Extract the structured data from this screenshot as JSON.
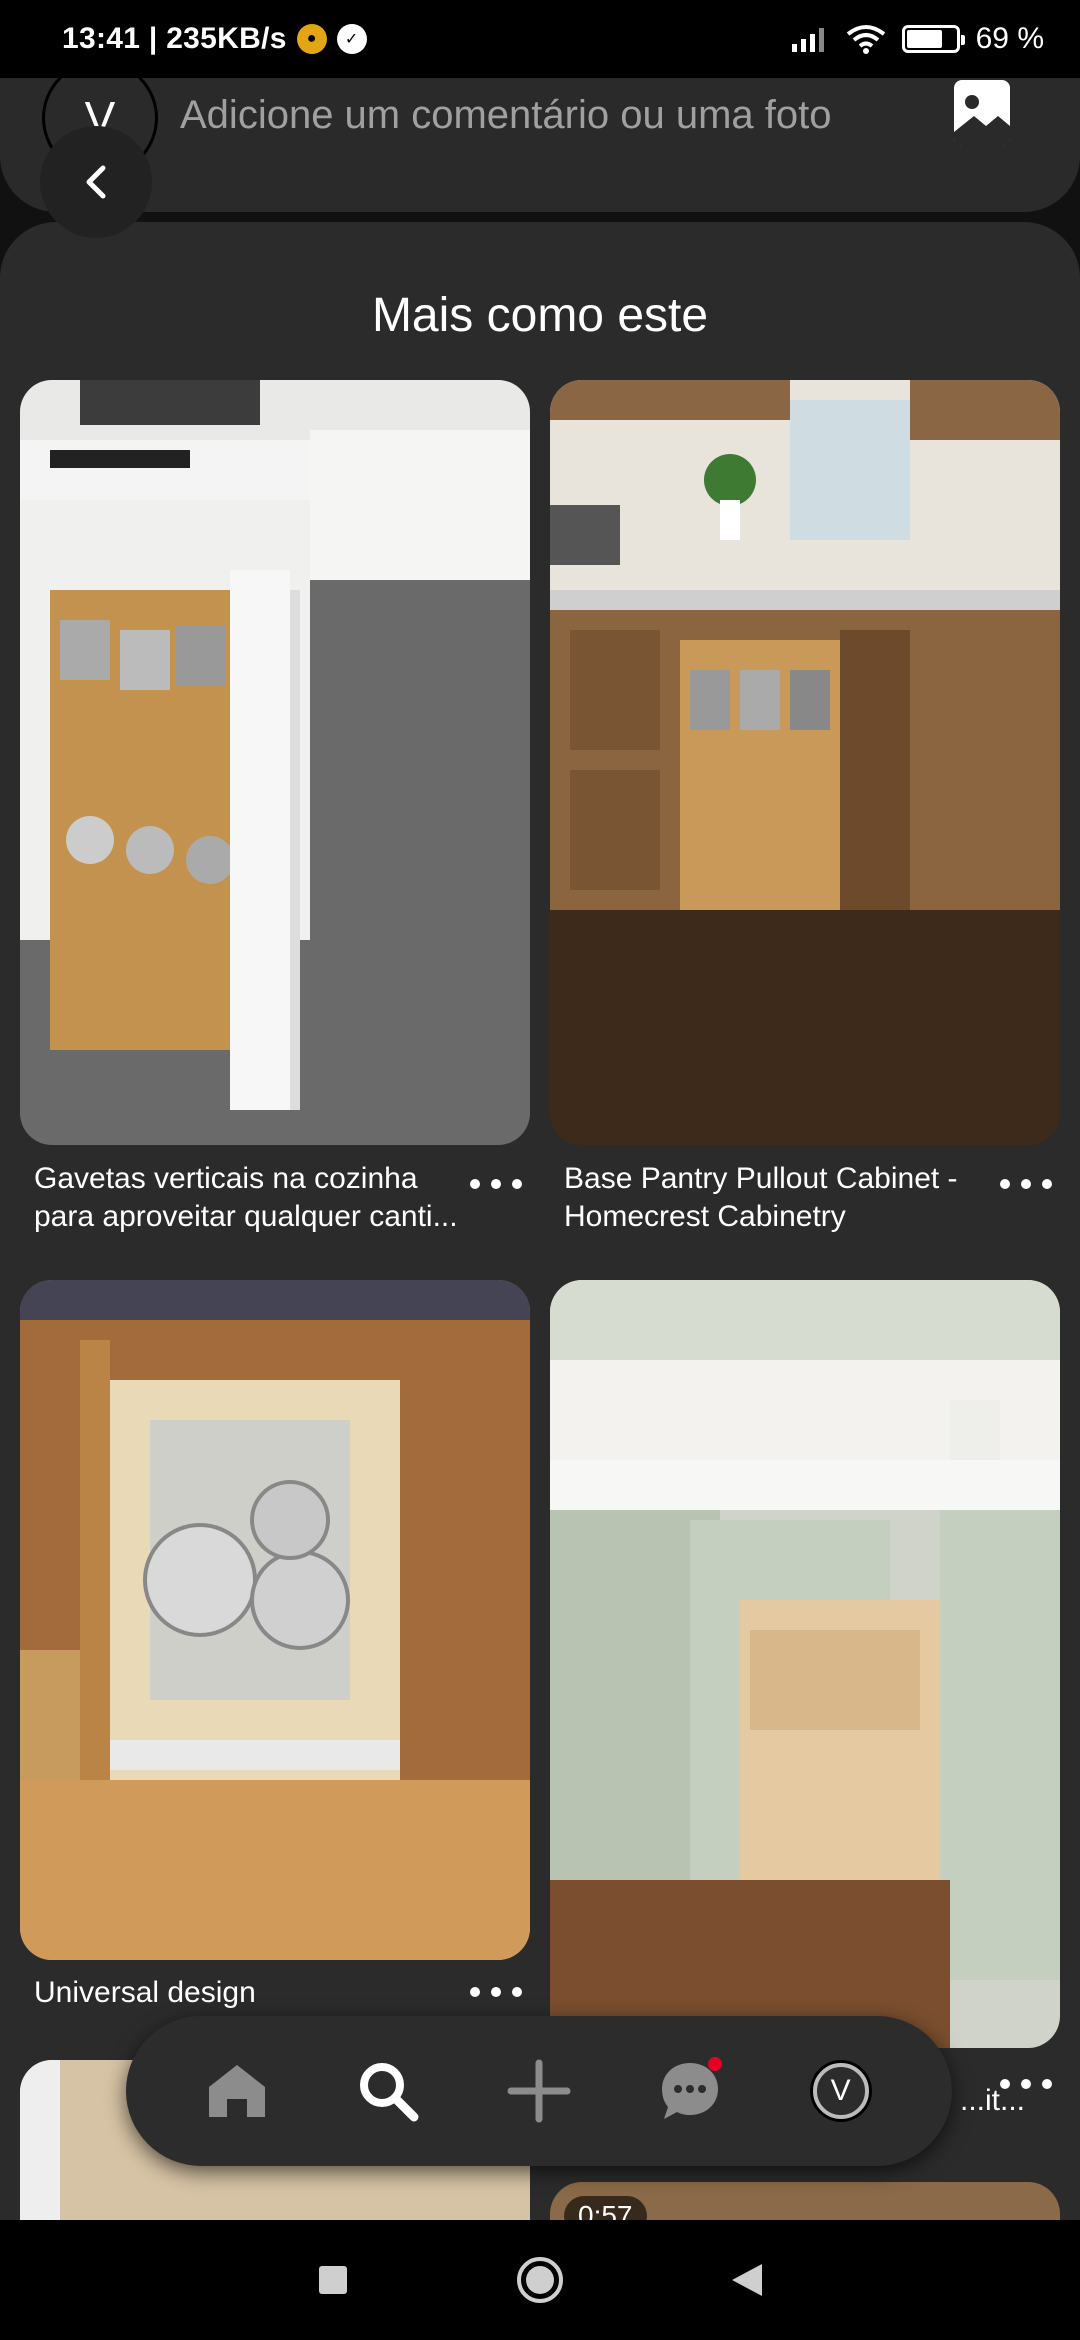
{
  "status_bar": {
    "time_speed": "13:41 | 235KB/s",
    "battery_percent": "69 %",
    "battery_level": 0.69
  },
  "comment": {
    "avatar_letter": "V",
    "placeholder": "Adicione um comentário ou uma foto"
  },
  "related": {
    "title": "Mais como este",
    "pins": [
      {
        "caption": "Gavetas verticais na cozinha para aproveitar qualquer canti..."
      },
      {
        "caption": "Base Pantry Pullout Cabinet - Homecrest Cabinetry"
      },
      {
        "caption": "Universal design"
      },
      {
        "caption": "...it..."
      }
    ],
    "partial_pin_badge": "0:57"
  },
  "bottom_nav": {
    "profile_letter": "V",
    "items": [
      "home",
      "search",
      "create",
      "messages",
      "profile"
    ]
  },
  "colors": {
    "background": "#2b2b2b",
    "notification": "#e60023"
  }
}
